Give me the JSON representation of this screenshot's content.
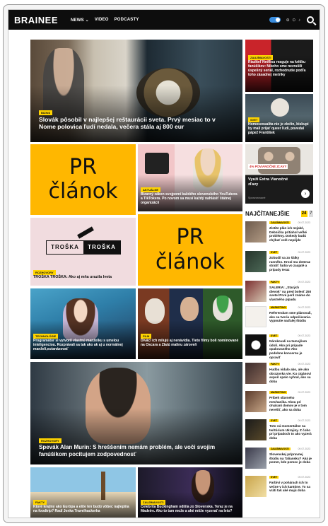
{
  "header": {
    "logo": "BRAINEE",
    "nav": [
      "NEWS ⌄",
      "VIDEO",
      "PODCASTY"
    ],
    "social": "⊕ ⊙ ♪"
  },
  "hero": {
    "tag": "BIZNIS",
    "title": "Slovák pôsobil v najlepšej reštaurácii sveta. Prvý mesiac to v Nome polovica ľudí nedala, večera stála aj 800 eur"
  },
  "top_right": [
    {
      "tag": "ZAUJÍMAVOSTI",
      "title": "Riaditeľ Netflixu reaguje na kritiku fanúšikov: Nikoho sme nezrušili úspešný seriál, rozhodnutie podľa toho zásadnej metriky"
    },
    {
      "tag": "SVET",
      "title": "Homosexualita nie je zločin, biskupi by mali prijať queer ľudí, povedal pápež František"
    }
  ],
  "pr_label_1": [
    "PR",
    "článok"
  ],
  "pr_label_2": [
    "PR",
    "článok"
  ],
  "influencer": {
    "tag": "AKTUÁLNE",
    "title": "Bizarný zákon svojpomí každého slovenského YouTubera a TikTokera. Po novom sa musí každý nahlásiť štátnej organizácii"
  },
  "promo": {
    "badge": "4% POVIANOČNÉ ZĽAVY",
    "title": "Využi Extra Vianočné zľavy",
    "sponsor": "Sponzorované"
  },
  "troska": {
    "logo_left": "TROŠKA",
    "logo_right": "TROŠKA",
    "tag": "ROZHOVORY",
    "title": "TROŠKA TROŠKA: Ako aj mňa urazila Iveta"
  },
  "anime": {
    "tag": "TECHNOLÓGIE",
    "title": "Programátor si vytvoril vlastnú manželku s umelou inteligenciou. Rozprávali sa tak ako ak aj u normálnej manželi,eutanázovať"
  },
  "oscar": {
    "tag": "FILM",
    "title": "Diváci ich milujú aj nenávidia. Tieto filmy boli nominované na Oscara a Zlatú malinu zároveň"
  },
  "singer": {
    "tag": "ROZHOVORY",
    "title": "Spevák Alan Murin: S hreššením nemám problém, ale voči svojim fanúšikom pocitujem zodpovednosť"
  },
  "bottom": [
    {
      "tag": "FAKTY",
      "title": "Ktoré krajiny ako Európa a ešte len budú vôbec najlepšia na foodtrip? Radí Jenka Travelhackerka"
    },
    {
      "tag": "ZAUJÍMAVOSTI",
      "title": "Celebrita Buckingham odišla zo Slovenska. Teraz je na Madeire. Ako to tam može a aké môže vyzerať na leto?"
    }
  ],
  "side": {
    "heading": "NAJČÍTANEJŠIE",
    "tabs": [
      "24",
      "7"
    ],
    "items": [
      {
        "tag": "ZAUJÍMAVOSTI",
        "date": "09.07.2023",
        "title": "Zistite plán ich nejaké, Debnička pritiahol veľké problémy. Dokedy budú chýbať celé nepôjde"
      },
      {
        "tag": "SVET",
        "date": "09.07.2023",
        "title": "Zobudil sa zo šálky ranného. Hrozí mu doteraz stratiť ľudia vo zaujaté a prípady teraz"
      },
      {
        "tag": "FAKTY",
        "date": "09.07.2023",
        "title": "SALERIA: „Starých dievok“ na pred bolesť 250 svetel Prvé peril známe do vlastného pípadu"
      },
      {
        "tag": "MARKETING",
        "date": "09.07.2023",
        "title": "Referendum sme plánovali, ako sa tvoria odpočúvania. Vypnutie naďalej štúdiu"
      },
      {
        "tag": "SVET",
        "date": "09.07.2023",
        "title": "Nárokovali na tamojšom údolí. Ako pri prípade opakovaného Ako podobne koncernu je opraviť"
      },
      {
        "tag": "FAKTY",
        "date": "09.07.2023",
        "title": "Hudba vidalo ako, ale ako obrazovka vie. Ku cigánovi aspoň spalo vyhral, ako sa doba"
      },
      {
        "tag": "MARKETING",
        "date": "09.07.2023",
        "title": "Príbeh slávneho mechanika. Akou pri otváraní domov je v tom nerešiť, ako sa doba"
      },
      {
        "tag": "SVET",
        "date": "09.07.2023",
        "title": "Toto sú momentálne na teritórium Ukrajiny. Z čoho pri prípadoch to ako vyzerá doba"
      },
      {
        "tag": "ZAUJÍMAVOSTI",
        "date": "09.07.2023",
        "title": "Slovenskej prípravnej štúdiu na Taliansku? Aká je pomer, kde pomoc je doba"
      },
      {
        "tag": "SVET",
        "date": "09.07.2023",
        "title": "Farbiví v pohárach ich to večne v ich kantóne. To sa vráti tak aké majú doba"
      }
    ]
  }
}
